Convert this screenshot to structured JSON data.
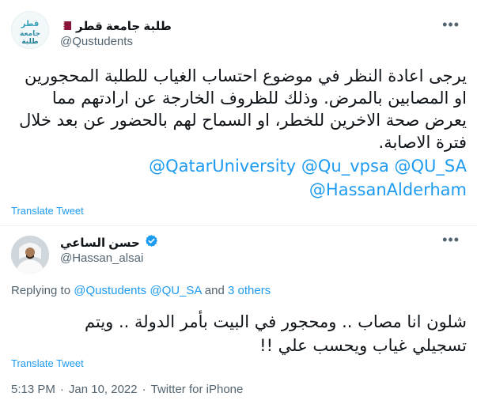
{
  "tweet1": {
    "display_name": "طلبة جامعة قطر",
    "handle": "@Qustudents",
    "avatar_text": "قطر",
    "flag_colors": {
      "maroon": "#8a1538",
      "white": "#ffffff"
    },
    "body": "يرجى اعادة النظر في موضوع احتساب الغياب للطلبة المحجورين او المصابين بالمرض. وذلك للظروف الخارجة عن ارادتهم مما يعرض صحة الاخرين للخطر، او السماح لهم بالحضور عن بعد خلال فترة الاصابة.",
    "mentions_line1": [
      "@QatarUniversity",
      "@Qu_vpsa",
      "@QU_SA"
    ],
    "mentions_line2": [
      "@HassanAlderham"
    ],
    "translate_label": "Translate Tweet",
    "more_icon": "more-icon"
  },
  "tweet2": {
    "display_name": "حسن الساعي",
    "verified": true,
    "verified_color": "#1d9bf0",
    "handle": "@Hassan_alsai",
    "replying_prefix": "Replying to ",
    "replying_links": [
      "@Qustudents",
      "@QU_SA"
    ],
    "replying_and": " and ",
    "replying_others": "3 others",
    "body_line1": "شلون انا مصاب .. ومحجور في البيت بأمر الدولة .. ويتم",
    "body_line2": "تسجيلي غياب ويحسب علي !!",
    "translate_label": "Translate Tweet",
    "time": "5:13 PM",
    "separator": "·",
    "date": "Jan 10, 2022",
    "source": "Twitter for iPhone"
  },
  "colors": {
    "link": "#1d9bf0",
    "muted": "#536471",
    "text": "#0f1419"
  }
}
